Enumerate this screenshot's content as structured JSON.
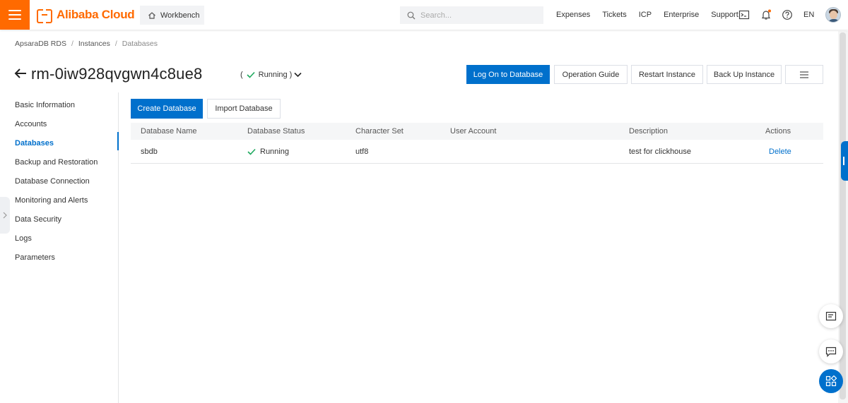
{
  "header": {
    "brand": "Alibaba Cloud",
    "workbench_label": "Workbench",
    "search_placeholder": "Search...",
    "nav": [
      "Expenses",
      "Tickets",
      "ICP",
      "Enterprise",
      "Support"
    ],
    "language": "EN"
  },
  "breadcrumb": [
    "ApsaraDB RDS",
    "Instances",
    "Databases"
  ],
  "instance": {
    "id": "rm-0iw928qvgwn4c8ue8",
    "status_prefix": "(",
    "status": "Running",
    "status_suffix": ")"
  },
  "actions": {
    "logon": "Log On to Database",
    "guide": "Operation Guide",
    "restart": "Restart Instance",
    "backup": "Back Up Instance"
  },
  "sidebar": {
    "items": [
      {
        "label": "Basic Information"
      },
      {
        "label": "Accounts"
      },
      {
        "label": "Databases"
      },
      {
        "label": "Backup and Restoration"
      },
      {
        "label": "Database Connection"
      },
      {
        "label": "Monitoring and Alerts"
      },
      {
        "label": "Data Security"
      },
      {
        "label": "Logs"
      },
      {
        "label": "Parameters"
      }
    ],
    "active": "Databases"
  },
  "toolbar": {
    "create": "Create Database",
    "import": "Import Database"
  },
  "table": {
    "columns": [
      "Database Name",
      "Database Status",
      "Character Set",
      "User Account",
      "Description",
      "Actions"
    ],
    "rows": [
      {
        "name": "sbdb",
        "status": "Running",
        "charset": "utf8",
        "account": "",
        "description": "test for clickhouse",
        "action": "Delete"
      }
    ]
  },
  "colors": {
    "brand": "#ff6a00",
    "primary": "#0070cc",
    "success": "#1ea95e"
  }
}
